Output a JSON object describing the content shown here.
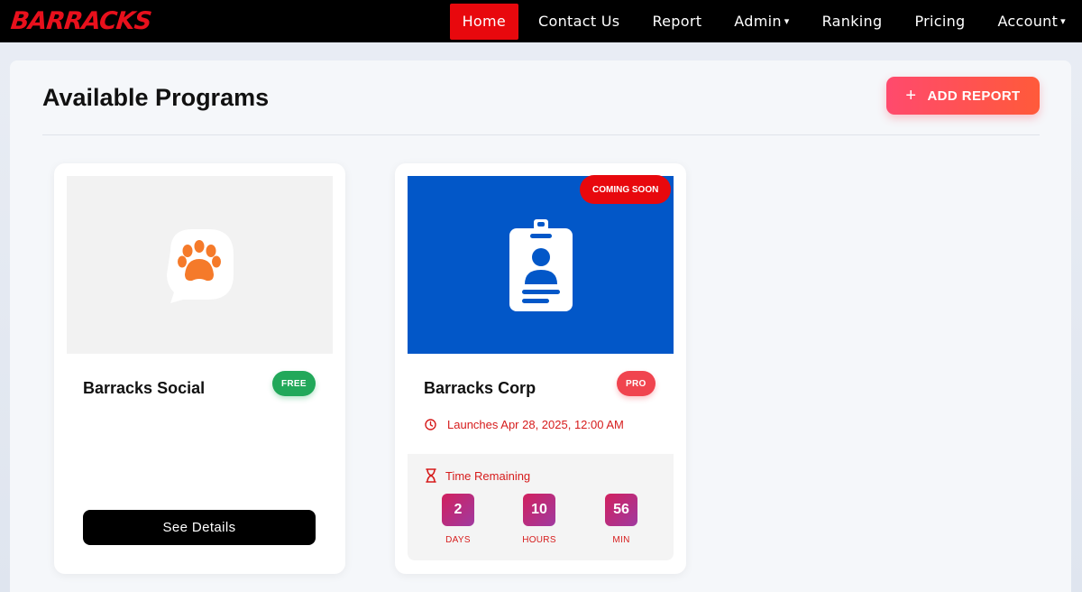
{
  "brand": {
    "logo_text": "BARRACKS",
    "accent": "#e8080d"
  },
  "nav": {
    "items": [
      {
        "label": "Home",
        "active": true
      },
      {
        "label": "Contact Us"
      },
      {
        "label": "Report"
      },
      {
        "label": "Admin",
        "caret": "▾"
      },
      {
        "label": "Ranking"
      },
      {
        "label": "Pricing"
      },
      {
        "label": "Account",
        "caret": "▾"
      }
    ]
  },
  "page": {
    "title": "Available Programs",
    "add_button": {
      "icon": "plus-icon",
      "label": "ADD REPORT"
    }
  },
  "programs": [
    {
      "name": "Barracks Social",
      "badge": "FREE",
      "icon": "paw-chat-icon",
      "action": "See Details"
    },
    {
      "name": "Barracks Corp",
      "badge": "PRO",
      "ribbon": "COMING SOON",
      "icon": "id-badge-icon",
      "launch_text": "Launches Apr 28, 2025, 12:00 AM",
      "countdown": {
        "label": "Time Remaining",
        "units": [
          {
            "value": "2",
            "label": "DAYS"
          },
          {
            "value": "10",
            "label": "HOURS"
          },
          {
            "value": "56",
            "label": "MIN"
          }
        ]
      }
    }
  ]
}
